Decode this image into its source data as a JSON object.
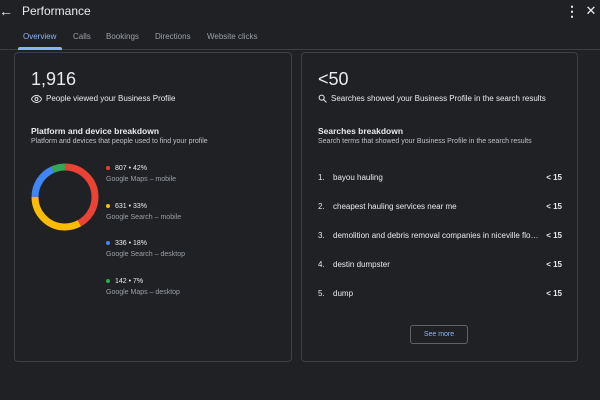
{
  "header": {
    "title": "Performance",
    "back_icon": "arrow-back-icon",
    "more_icon": "more-vert-icon",
    "close_icon": "close-icon"
  },
  "tabs": [
    {
      "label": "Overview",
      "active": true
    },
    {
      "label": "Calls",
      "active": false
    },
    {
      "label": "Bookings",
      "active": false
    },
    {
      "label": "Directions",
      "active": false
    },
    {
      "label": "Website clicks",
      "active": false
    }
  ],
  "profile_views": {
    "value": "1,916",
    "caption": "People viewed your Business Profile",
    "icon": "eye-icon"
  },
  "platform": {
    "title": "Platform and device breakdown",
    "subtitle": "Platform and devices that people used to find your profile",
    "items": [
      {
        "value": "807 • 42%",
        "label": "Google Maps – mobile",
        "color": "#ea4335",
        "percent": 42
      },
      {
        "value": "631 • 33%",
        "label": "Google Search – mobile",
        "color": "#fbbc04",
        "percent": 33
      },
      {
        "value": "336 • 18%",
        "label": "Google Search – desktop",
        "color": "#4285f4",
        "percent": 18
      },
      {
        "value": "142 • 7%",
        "label": "Google Maps – desktop",
        "color": "#34a853",
        "percent": 7
      }
    ]
  },
  "searches": {
    "value": "<50",
    "caption": "Searches showed your Business Profile in the search results",
    "icon": "search-icon"
  },
  "breakdown": {
    "title": "Searches breakdown",
    "subtitle": "Search terms that showed your Business Profile in the search results",
    "rows": [
      {
        "num": "1.",
        "term": "bayou hauling",
        "count": "< 15"
      },
      {
        "num": "2.",
        "term": "cheapest hauling services near me",
        "count": "< 15"
      },
      {
        "num": "3.",
        "term": "demolition and debris removal companies in niceville florida",
        "count": "< 15"
      },
      {
        "num": "4.",
        "term": "destin dumpster",
        "count": "< 15"
      },
      {
        "num": "5.",
        "term": "dump",
        "count": "< 15"
      }
    ],
    "see_more": "See more"
  },
  "colors": {
    "accent": "#8ab4f8",
    "background": "#202124",
    "border": "#3c4043"
  }
}
